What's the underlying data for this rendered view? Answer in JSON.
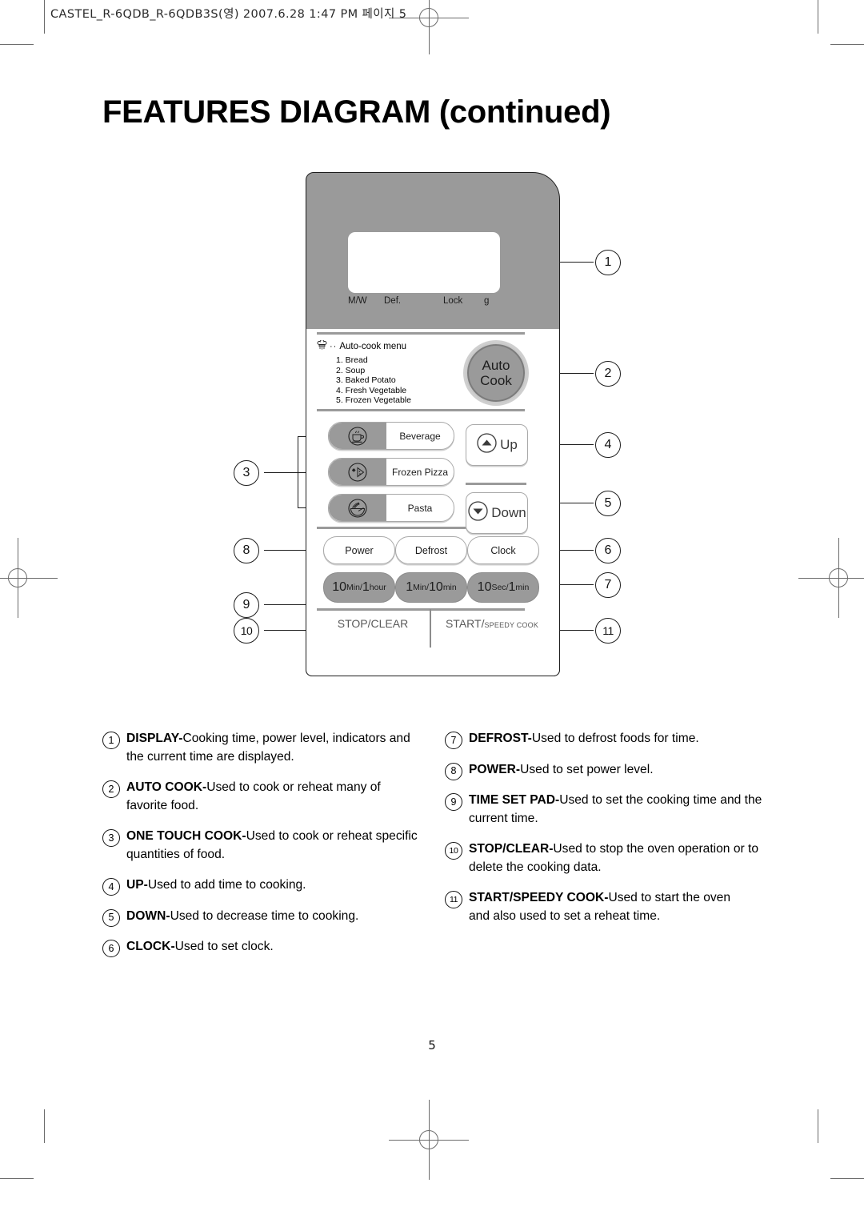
{
  "print": {
    "slug": "CASTEL_R-6QDB_R-6QDB3S(영) 2007.6.28 1:47 PM 페이지 5",
    "page_number": "5"
  },
  "header": {
    "title": "FEATURES DIAGRAM (continued)"
  },
  "panel": {
    "display": {
      "indicators": [
        "M/W",
        "Def.",
        "Lock",
        "g"
      ]
    },
    "auto_cook": {
      "menu_heading": "Auto-cook menu",
      "dots": "··",
      "items": [
        "1. Bread",
        "2. Soup",
        "3. Baked Potato",
        "4. Fresh Vegetable",
        "5. Frozen Vegetable"
      ],
      "button_line1": "Auto",
      "button_line2": "Cook"
    },
    "one_touch": [
      {
        "label": "Beverage",
        "icon": "cup-icon"
      },
      {
        "label": "Frozen Pizza",
        "icon": "pizza-slice-icon"
      },
      {
        "label": "Pasta",
        "icon": "pasta-bowl-icon"
      }
    ],
    "updown": [
      {
        "label": "Up",
        "icon": "chevron-up-icon"
      },
      {
        "label": "Down",
        "icon": "chevron-down-icon"
      }
    ],
    "function_buttons": [
      "Power",
      "Defrost",
      "Clock"
    ],
    "time_pads": [
      {
        "big1": "10",
        "sm1": "Min",
        "slash": "/",
        "big2": "1",
        "sm2": "hour"
      },
      {
        "big1": "1",
        "sm1": "Min",
        "slash": "/",
        "big2": "10",
        "sm2": "min"
      },
      {
        "big1": "10",
        "sm1": "Sec",
        "slash": "/",
        "big2": "1",
        "sm2": "min"
      }
    ],
    "stop_clear": "STOP/CLEAR",
    "start_main": "START/",
    "start_sub": "SPEEDY COOK"
  },
  "callouts": [
    "1",
    "2",
    "3",
    "4",
    "5",
    "6",
    "7",
    "8",
    "9",
    "10",
    "11"
  ],
  "descriptions": {
    "left": [
      {
        "num": "1",
        "term": "DISPLAY-",
        "body": "Cooking time, power level, indicators and the current time are displayed."
      },
      {
        "num": "2",
        "term": "AUTO COOK-",
        "body": "Used to cook or reheat many of favorite food."
      },
      {
        "num": "3",
        "term": "ONE TOUCH COOK-",
        "body": "Used to cook or reheat specific quantities of food."
      },
      {
        "num": "4",
        "term": "UP-",
        "body": "Used to add time to cooking."
      },
      {
        "num": "5",
        "term": "DOWN-",
        "body": "Used to decrease time to cooking."
      },
      {
        "num": "6",
        "term": "CLOCK-",
        "body": "Used to set clock."
      }
    ],
    "right": [
      {
        "num": "7",
        "term": "DEFROST-",
        "body": "Used to defrost foods for time."
      },
      {
        "num": "8",
        "term": "POWER-",
        "body": "Used to set power level."
      },
      {
        "num": "9",
        "term": "TIME SET PAD-",
        "body": "Used to set the cooking time and the current time."
      },
      {
        "num": "10",
        "term": "STOP/CLEAR-",
        "body": "Used to stop the oven operation or to delete the cooking data."
      },
      {
        "num": "11",
        "term": "START/SPEEDY COOK-",
        "body": "Used to start the oven\nand also used to set a reheat time."
      }
    ]
  }
}
